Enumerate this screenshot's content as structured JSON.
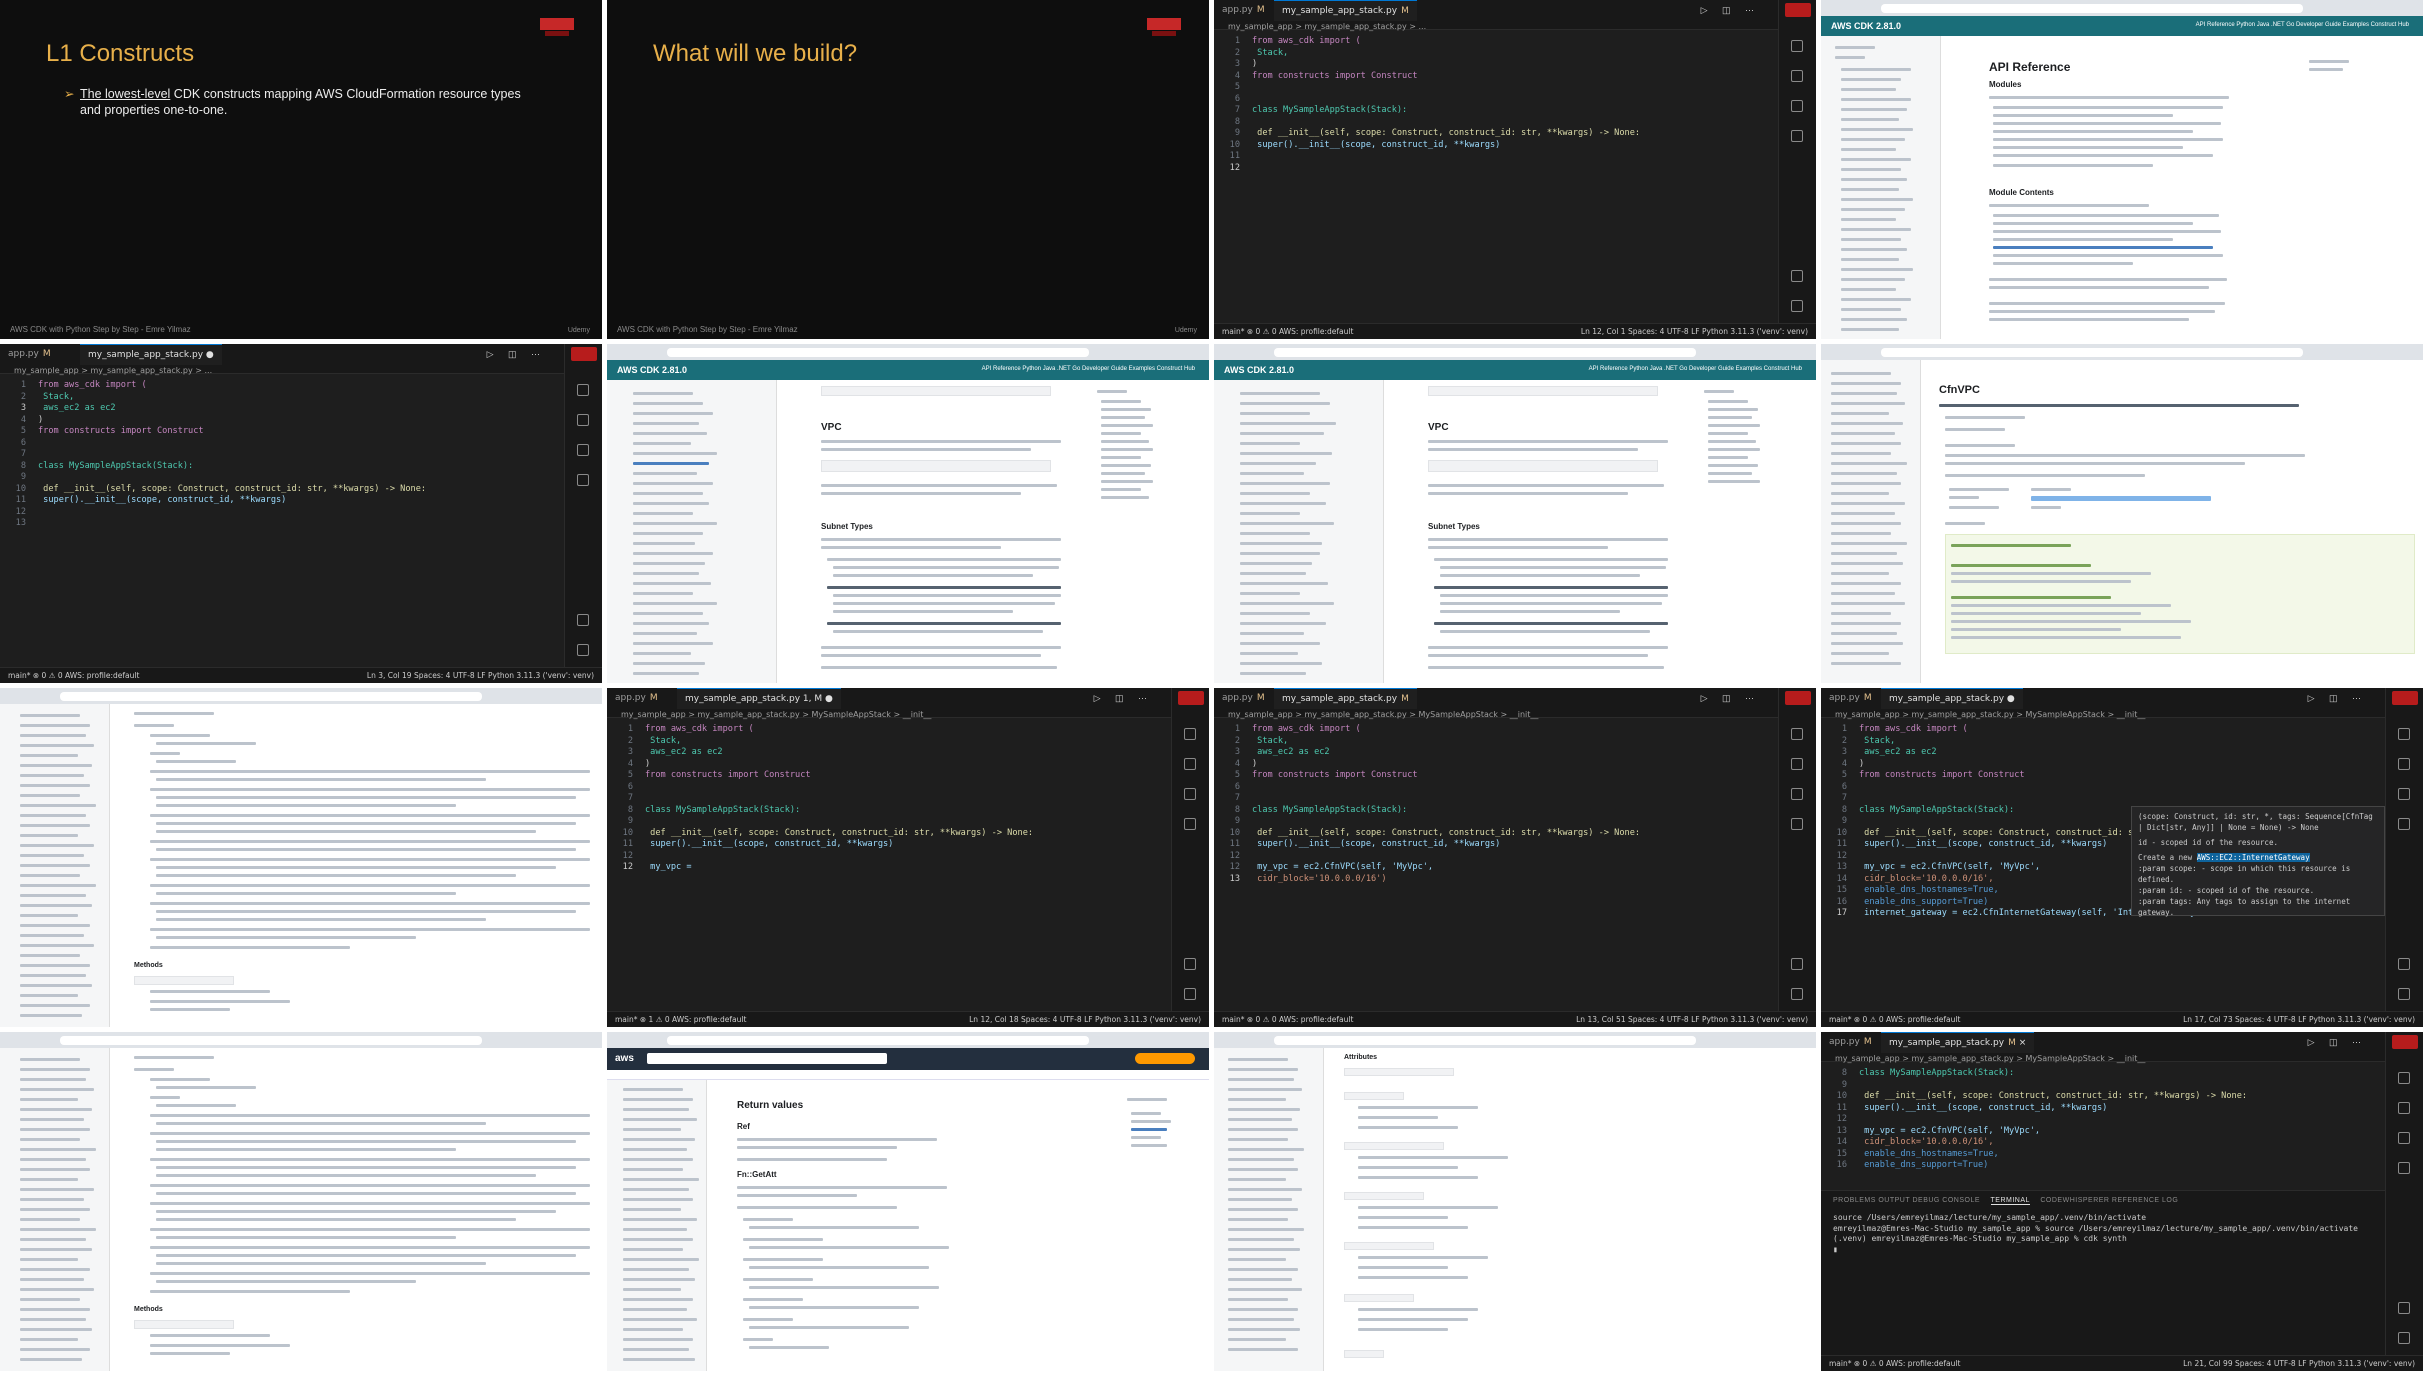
{
  "slides": {
    "s1": {
      "title": "L1 Constructs",
      "bullet_underlined": "The lowest-level",
      "bullet_rest": " CDK constructs mapping AWS CloudFormation resource types and properties one-to-one.",
      "footer": "AWS CDK with Python Step by Step - Emre Yilmaz",
      "footer_right": "Udemy"
    },
    "s2": {
      "title": "What will we build?",
      "footer": "AWS CDK with Python Step by Step - Emre Yilmaz",
      "footer_right": "Udemy"
    }
  },
  "tabs": {
    "app": "app.py",
    "stack": "my_sample_app_stack.py",
    "modified": "M",
    "stack_err": "my_sample_app_stack.py 1, M"
  },
  "breadcrumbs": {
    "short": "my_sample_app > my_sample_app_stack.py > ...",
    "class": "my_sample_app > my_sample_app_stack.py > MySampleAppStack > __init__"
  },
  "status": {
    "branch": "main*",
    "sync": "⊗ 0 ⚠ 0",
    "sync2": "⊗ 1 ⚠ 0",
    "aws": "AWS: profile:default",
    "spaces": "Spaces: 4",
    "enc": "UTF-8",
    "eol": "LF",
    "lang": "Python",
    "py": "3.11.3 ('venv': venv)",
    "pos1": "Ln 12, Col 1",
    "pos2": "Ln 3, Col 19",
    "pos3": "Ln 12, Col 18",
    "pos4": "Ln 13, Col 51",
    "pos5": "Ln 17, Col 73",
    "pos6": "Ln 21, Col 99"
  },
  "code": {
    "l_from_cdk": "from aws_cdk import (",
    "l_stack": "    Stack,",
    "l_ec2": "    aws_ec2 as ec2",
    "l_paren": ")",
    "l_from_constructs": "from constructs import Construct",
    "l_class": "class MySampleAppStack(Stack):",
    "l_def": "    def __init__(self, scope: Construct, construct_id: str, **kwargs) -> None:",
    "l_super": "        super().__init__(scope, construct_id, **kwargs)",
    "l_myvpc_partial": "        my_vpc =",
    "l_myvpc": "        my_vpc = ec2.CfnVPC(self, 'MyVpc',",
    "l_cidr": "                            cidr_block='10.0.0.0/16')",
    "l_cidr2": "                            cidr_block='10.0.0.0/16',",
    "l_dnsh": "                            enable_dns_hostnames=True,",
    "l_dnss": "                            enable_dns_support=True)",
    "l_igw": "        internet_gateway = ec2.CfnInternetGateway(self, 'InternetGateway')"
  },
  "hint": {
    "sig": "(scope: Construct, id: str, *, tags: Sequence[CfnTag | Dict[str, Any]] | None = None) -> None",
    "id_doc": "id - scoped id of the resource.",
    "create": "Create a new",
    "create_hl": "AWS::EC2::InternetGateway",
    "p1": ":param scope: - scope in which this resource is defined.",
    "p2": ":param id: - scoped id of the resource.",
    "p3": ":param tags: Any tags to assign to the internet gateway."
  },
  "terminal": {
    "tabs": [
      "PROBLEMS",
      "OUTPUT",
      "DEBUG CONSOLE",
      "TERMINAL",
      "CODEWHISPERER REFERENCE LOG"
    ],
    "active": "TERMINAL",
    "lines": [
      "source /Users/emreyilmaz/lecture/my_sample_app/.venv/bin/activate",
      "emreyilmaz@Emres-Mac-Studio my_sample_app % source /Users/emreyilmaz/lecture/my_sample_app/.venv/bin/activate",
      "(.venv) emreyilmaz@Emres-Mac-Studio my_sample_app % cdk synth"
    ]
  },
  "docs": {
    "cdk_logo": "AWS CDK  2.81.0",
    "cdk_nav": "API Reference   Python   Java   .NET   Go   Developer Guide   Examples   Construct Hub",
    "api_title": "API Reference",
    "api_modules": "Modules",
    "api_contents": "Module Contents",
    "vpc_title": "VPC",
    "subnet_types": "Subnet Types",
    "cfnvpc_title": "CfnVPC",
    "return_values": "Return values",
    "ref": "Ref",
    "fngetatt": "Fn::GetAtt",
    "attributes": "Attributes",
    "methods": "Methods"
  }
}
